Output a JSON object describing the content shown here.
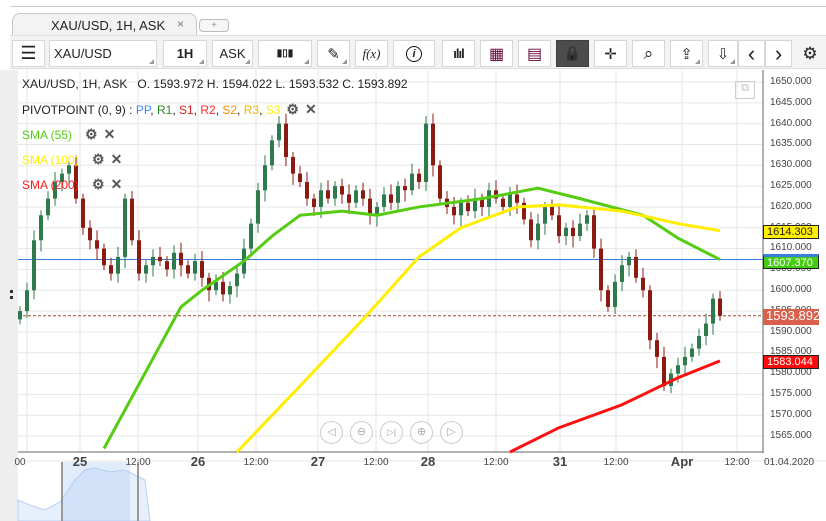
{
  "tab": {
    "title": "XAU/USD, 1H, ASK",
    "close": "×",
    "new_tab": "+"
  },
  "toolbar": {
    "menu": "☰",
    "symbol": "XAU/USD",
    "period": "1H",
    "side": "ASK",
    "chart_type": "▮▯▮",
    "draw": "✎",
    "fx": "f(x)",
    "info": "i",
    "volume": "ılıl",
    "calendar": "▦",
    "news": "▤",
    "lock": "🔒",
    "crosshair": "✛",
    "zoom_search": "⌕",
    "upload": "⇪",
    "download": "⇩",
    "prev": "‹",
    "next": "›",
    "settings": "⚙"
  },
  "legend": {
    "header": "XAU/USD, 1H, ASK",
    "ohlc": "O. 1593.972 H. 1594.022 L. 1593.532 C. 1593.892",
    "pivot": "PIVOTPOINT (0, 9)",
    "pivot_sep": " : ",
    "pivot_items": [
      {
        "t": "PP",
        "c": "#3b8cff"
      },
      {
        "t": "R1",
        "c": "#2a8a2a"
      },
      {
        "t": "S1",
        "c": "#d42020"
      },
      {
        "t": "R2",
        "c": "#ff2a2a"
      },
      {
        "t": "S2",
        "c": "#ff8c00"
      },
      {
        "t": "R3",
        "c": "#f5b800"
      },
      {
        "t": "S3",
        "c": "#ffee00"
      }
    ],
    "sma": [
      {
        "label": "SMA (55)",
        "color": "#55cc11"
      },
      {
        "label": "SMA (100)",
        "color": "#ffee00"
      },
      {
        "label": "SMA (200)",
        "color": "#ff2020"
      }
    ],
    "gear": "⚙",
    "close": "✕"
  },
  "price_axis": [
    "1650.000",
    "1645.000",
    "1640.000",
    "1635.000",
    "1630.000",
    "1625.000",
    "1620.000",
    "1615.000",
    "1610.000",
    "1605.000",
    "1600.000",
    "1595.000",
    "1590.000",
    "1585.000",
    "1580.000",
    "1575.000",
    "1570.000",
    "1565.000"
  ],
  "time_axis": [
    {
      "t": "00",
      "d": false
    },
    {
      "t": "25",
      "d": true
    },
    {
      "t": "12:00",
      "d": false
    },
    {
      "t": "26",
      "d": true
    },
    {
      "t": "12:00",
      "d": false
    },
    {
      "t": "27",
      "d": true
    },
    {
      "t": "12:00",
      "d": false
    },
    {
      "t": "28",
      "d": true
    },
    {
      "t": "12:00",
      "d": false
    },
    {
      "t": "31",
      "d": true
    },
    {
      "t": "12:00",
      "d": false
    },
    {
      "t": "Apr",
      "d": true
    },
    {
      "t": "12:00",
      "d": false
    },
    {
      "t": "01.04.2020",
      "d": false
    }
  ],
  "tags": {
    "sma100": "1614.303",
    "sma55": "1607.370",
    "last": "1593.892",
    "sma200": "1583.044"
  },
  "nav_buttons": [
    "◁",
    "⊖",
    "▷|",
    "⊕",
    "▷"
  ],
  "chart_data": {
    "type": "candlestick",
    "first_open": 1593,
    "closes": [
      1595,
      1600,
      1612,
      1618,
      1622,
      1626,
      1628,
      1630,
      1622,
      1615,
      1612,
      1610,
      1606,
      1604,
      1608,
      1622,
      1612,
      1604,
      1606,
      1608,
      1607,
      1605,
      1609,
      1606,
      1604,
      1607,
      1603,
      1600,
      1602,
      1599,
      1601,
      1604,
      1610,
      1616,
      1624,
      1630,
      1636,
      1640,
      1632,
      1628,
      1626,
      1622,
      1620,
      1624,
      1622,
      1625,
      1623,
      1621,
      1624,
      1622,
      1618,
      1620,
      1623,
      1621,
      1625,
      1624,
      1628,
      1626,
      1640,
      1630,
      1622,
      1620,
      1618,
      1621,
      1619,
      1622,
      1620,
      1624,
      1622,
      1620,
      1623,
      1621,
      1617,
      1612,
      1616,
      1620,
      1618,
      1613,
      1615,
      1613,
      1616,
      1618,
      1610,
      1600,
      1596,
      1602,
      1606,
      1608,
      1603,
      1600,
      1588,
      1584,
      1577,
      1580,
      1582,
      1584,
      1586,
      1589,
      1592,
      1598,
      1593.892
    ],
    "sma55": [
      [
        12,
        1562
      ],
      [
        23,
        1596
      ],
      [
        26,
        1600
      ],
      [
        32,
        1607
      ],
      [
        36,
        1613
      ],
      [
        40,
        1618
      ],
      [
        46,
        1619
      ],
      [
        51,
        1618
      ],
      [
        57,
        1620
      ],
      [
        66,
        1622
      ],
      [
        74,
        1624.5
      ],
      [
        80,
        1622
      ],
      [
        89,
        1618
      ],
      [
        94,
        1612.5
      ],
      [
        100,
        1607.37
      ]
    ],
    "sma100": [
      [
        31,
        1561
      ],
      [
        40,
        1577
      ],
      [
        49,
        1593
      ],
      [
        57,
        1608
      ],
      [
        63,
        1615
      ],
      [
        71,
        1620
      ],
      [
        77,
        1620.5
      ],
      [
        86,
        1619
      ],
      [
        94,
        1616
      ],
      [
        100,
        1614.303
      ]
    ],
    "sma200": [
      [
        70,
        1561
      ],
      [
        77,
        1567
      ],
      [
        86,
        1572.5
      ],
      [
        94,
        1579
      ],
      [
        100,
        1583.044
      ]
    ],
    "ylim": [
      1562,
      1653
    ],
    "colors": {
      "up": "#2f7a4c",
      "down": "#8b1a12",
      "pp_line": "#3b7ddd",
      "last_line": "#a0402a"
    }
  }
}
